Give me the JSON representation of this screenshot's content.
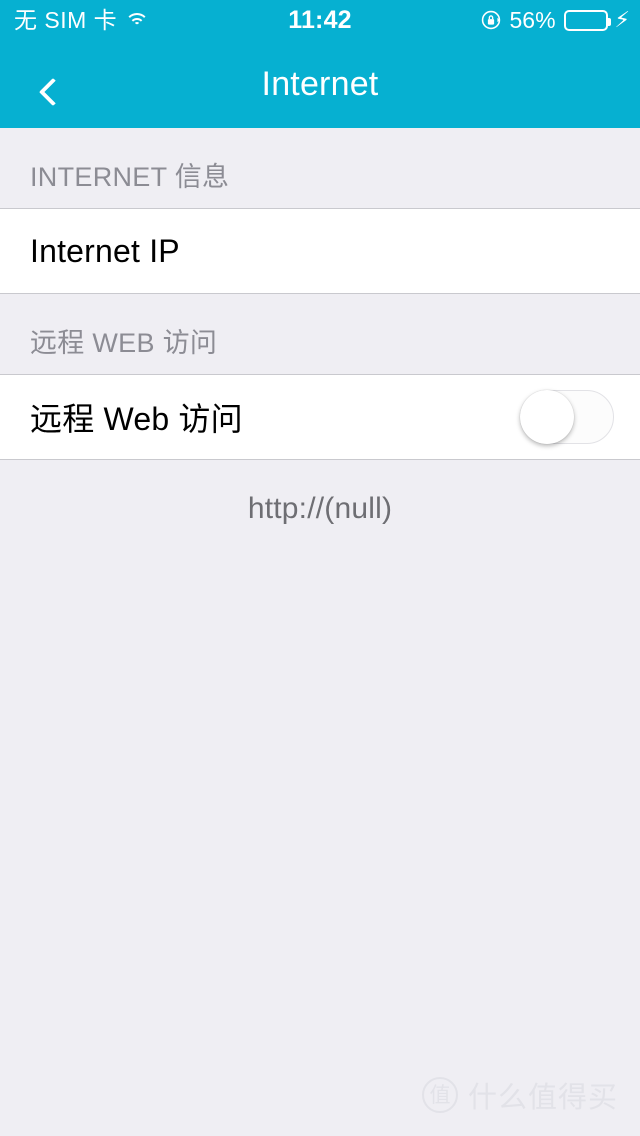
{
  "status_bar": {
    "carrier": "无 SIM 卡",
    "wifi_icon": "wifi-icon",
    "time": "11:42",
    "rotation_lock_icon": "rotation-lock-icon",
    "battery_percent": "56%",
    "battery_level": 56,
    "battery_fill_color": "#4cd964",
    "charging_icon": "⚡"
  },
  "nav_bar": {
    "back_icon": "chevron-left-icon",
    "title": "Internet",
    "background_color": "#06b0d1"
  },
  "sections": [
    {
      "header": "INTERNET 信息",
      "rows": [
        {
          "label": "Internet IP",
          "value": "",
          "type": "value"
        }
      ]
    },
    {
      "header": "远程 WEB 访问",
      "rows": [
        {
          "label": "远程 Web 访问",
          "type": "switch",
          "switch_on": false
        }
      ],
      "footnote": "http://(null)"
    }
  ],
  "watermark": {
    "logo_text": "值",
    "text": "什么值得买"
  }
}
